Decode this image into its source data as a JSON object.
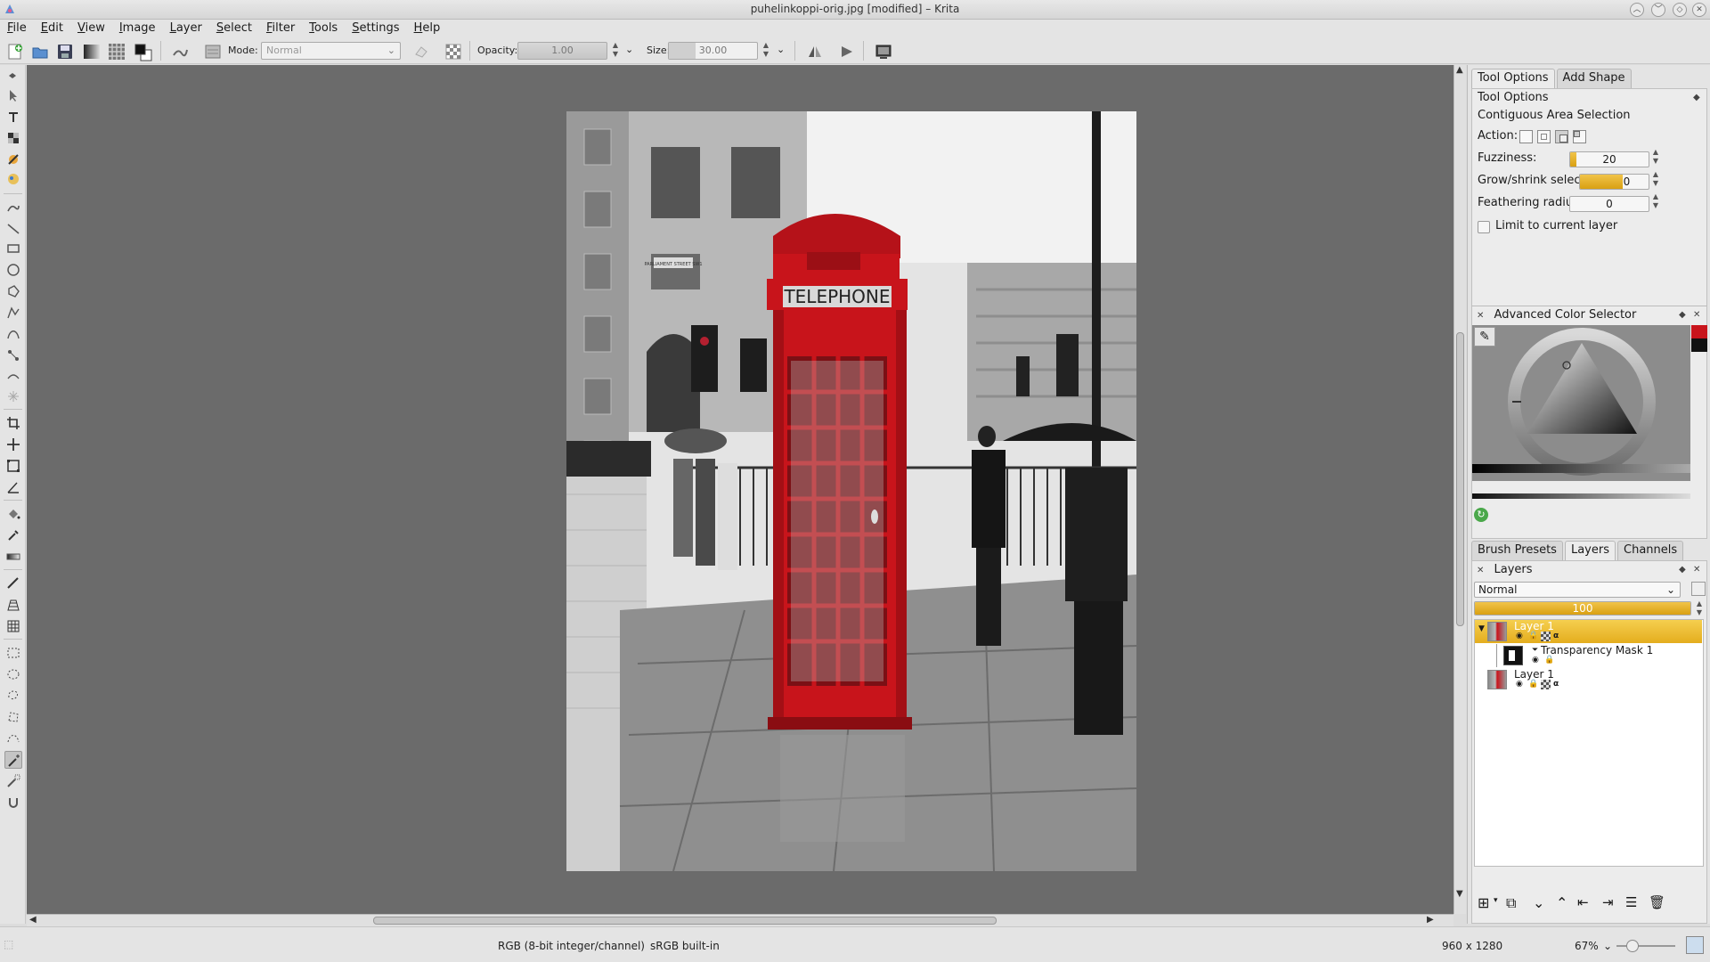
{
  "window": {
    "title": "puhelinkoppi-orig.jpg [modified] – Krita"
  },
  "menu": [
    "File",
    "Edit",
    "View",
    "Image",
    "Layer",
    "Select",
    "Filter",
    "Tools",
    "Settings",
    "Help"
  ],
  "toolbar": {
    "mode_label": "Mode:",
    "mode_value": "Normal",
    "opacity_label": "Opacity:",
    "opacity_value": "1.00",
    "size_label": "Size:",
    "size_value": "30.00"
  },
  "dock_tabs_top": [
    "Tool Options",
    "Add Shape"
  ],
  "tool_options": {
    "title": "Tool Options",
    "tool_name": "Contiguous Area Selection",
    "action_label": "Action:",
    "fuzziness_label": "Fuzziness:",
    "fuzziness_value": "20",
    "fuzziness_fraction": 0.08,
    "grow_label": "Grow/shrink selection:",
    "grow_value": "0",
    "feather_label": "Feathering radius:",
    "feather_value": "0",
    "limit_label": "Limit to current layer",
    "limit_checked": false
  },
  "color_selector": {
    "title": "Advanced Color Selector"
  },
  "dock_tabs_bottom": [
    "Brush Presets",
    "Layers",
    "Channels"
  ],
  "layers": {
    "title": "Layers",
    "blend_mode": "Normal",
    "opacity_value": "100",
    "items": [
      {
        "name": "Layer 1",
        "selected": true
      },
      {
        "name": "Transparency Mask 1",
        "selected": false
      },
      {
        "name": "Layer 1",
        "selected": false
      }
    ]
  },
  "status": {
    "color_model": "RGB (8-bit integer/channel)",
    "profile": "sRGB built-in",
    "dimensions": "960 x 1280",
    "zoom": "67%"
  },
  "photo": {
    "sign_text": "TELEPHONE",
    "street_sign": "PARLIAMENT STREET SW1"
  },
  "colors": {
    "accent": "#e9b325",
    "canvas_bg": "#6b6b6b",
    "booth_red": "#c8141b"
  }
}
